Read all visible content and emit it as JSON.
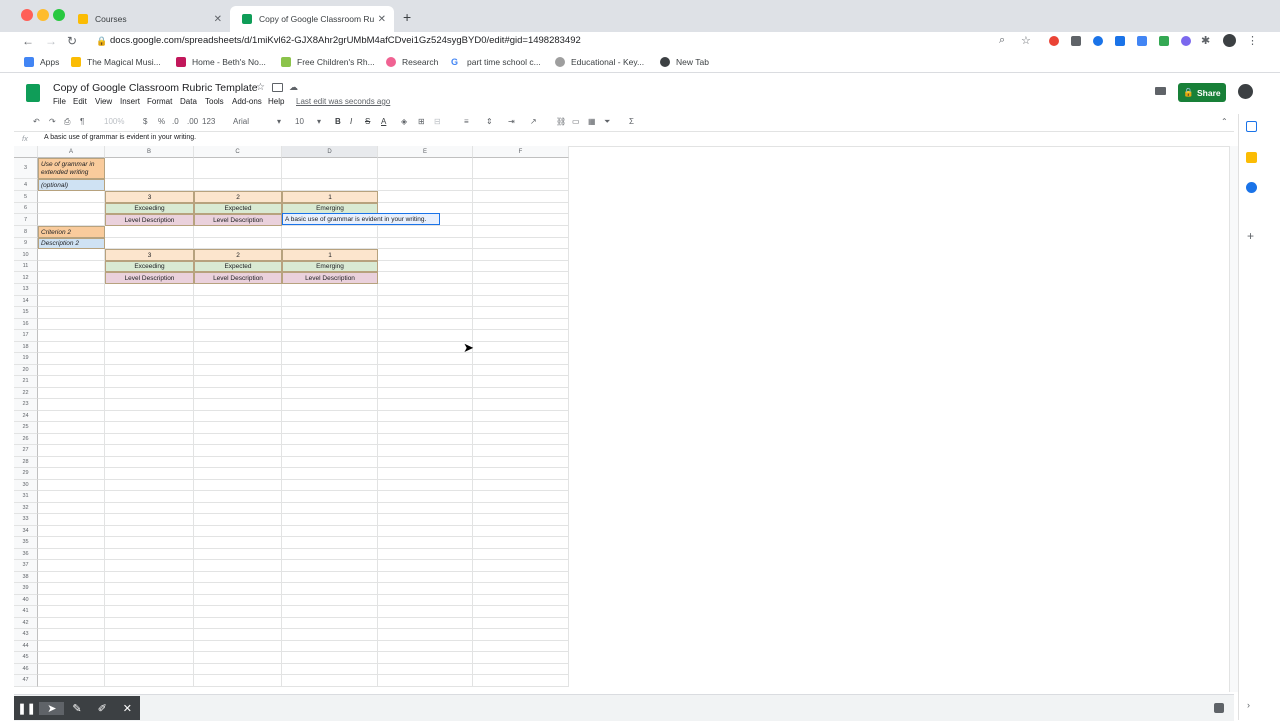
{
  "browser": {
    "tabs": [
      {
        "label": "Courses"
      },
      {
        "label": "Copy of Google Classroom Ru"
      }
    ],
    "url": "docs.google.com/spreadsheets/d/1miKvl62-GJX8Ahr2grUMbM4afCDvei1Gz524sygBYD0/edit#gid=1498283492",
    "bookmarks": [
      "Apps",
      "The Magical Musi...",
      "Home - Beth's No...",
      "Free Children's Rh...",
      "Research",
      "part time school c...",
      "Educational - Key...",
      "New Tab"
    ]
  },
  "sheet": {
    "title": "Copy of Google Classroom Rubric Template",
    "menu": [
      "File",
      "Edit",
      "View",
      "Insert",
      "Format",
      "Data",
      "Tools",
      "Add-ons",
      "Help"
    ],
    "last_edit": "Last edit was seconds ago",
    "share_label": "Share",
    "toolbar": {
      "zoom": "100%",
      "currency": "$",
      "percent": "%",
      "dec_less": ".0",
      "dec_more": ".00",
      "format_more": "123",
      "font": "Arial",
      "font_size": "10",
      "bold": "B",
      "italic": "I",
      "strike": "S",
      "text_color": "A",
      "sigma": "Σ"
    },
    "formula_bar": {
      "fx": "fx",
      "content": "A basic use of grammar is evident in your writing."
    },
    "columns": [
      "A",
      "B",
      "C",
      "D",
      "E",
      "F"
    ],
    "rows": [
      "3",
      "4",
      "5",
      "6",
      "7",
      "8",
      "9",
      "10",
      "11",
      "12",
      "13",
      "14",
      "15",
      "16",
      "17",
      "18",
      "19",
      "20",
      "21",
      "22",
      "23",
      "24",
      "25",
      "26",
      "27",
      "28",
      "29",
      "30",
      "31",
      "32",
      "33",
      "34",
      "35",
      "36",
      "37",
      "38",
      "39",
      "40",
      "41",
      "42",
      "43",
      "44",
      "45",
      "46",
      "47"
    ],
    "cells": {
      "a3": "Use of grammar in extended writing",
      "a4": "(optional)",
      "b5": "3",
      "c5": "2",
      "d5": "1",
      "b6": "Exceeding",
      "c6": "Expected",
      "d6": "Emerging",
      "b7": "Level Description",
      "c7": "Level Description",
      "d7_edit": "A basic use of grammar is evident in your writing.",
      "a8": "Criterion 2",
      "a9": "Description 2",
      "b10": "3",
      "c10": "2",
      "d10": "1",
      "b11": "Exceeding",
      "c11": "Expected",
      "d11": "Emerging",
      "b12": "Level Description",
      "c12": "Level Description",
      "d12": "Level Description"
    }
  },
  "colors": {
    "orange": "#fce5cd",
    "label_orange": "#f9cb9c",
    "green": "#d9ead3",
    "pink": "#ead1dc",
    "blue": "#cfe2f3",
    "share": "#188038"
  }
}
